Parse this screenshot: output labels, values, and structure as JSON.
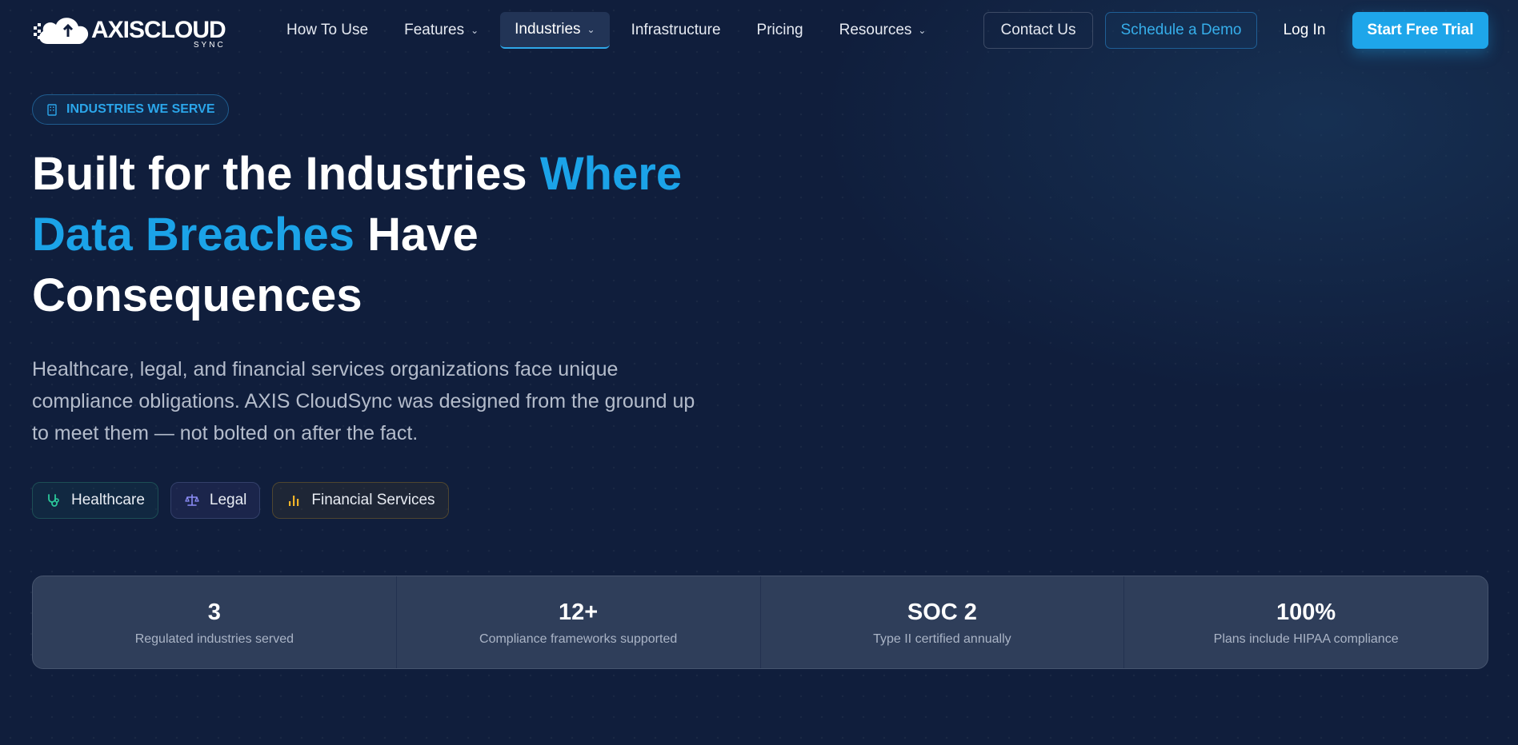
{
  "brand": {
    "name": "AXISCLOUD",
    "sub": "SYNC"
  },
  "nav": {
    "items": [
      {
        "label": "How To Use",
        "dropdown": false
      },
      {
        "label": "Features",
        "dropdown": true
      },
      {
        "label": "Industries",
        "dropdown": true,
        "active": true
      },
      {
        "label": "Infrastructure",
        "dropdown": false
      },
      {
        "label": "Pricing",
        "dropdown": false
      },
      {
        "label": "Resources",
        "dropdown": true
      }
    ],
    "contact": "Contact Us",
    "demo": "Schedule a Demo",
    "login": "Log In",
    "trial": "Start Free Trial"
  },
  "hero": {
    "badge": "INDUSTRIES WE SERVE",
    "headline_1": "Built for the Industries ",
    "headline_accent_1": "Where",
    "headline_accent_2": "Data Breaches",
    "headline_2": " Have",
    "headline_3": "Consequences",
    "subtitle": "Healthcare, legal, and financial services organizations face unique compliance obligations. AXIS CloudSync was designed from the ground up to meet them — not bolted on after the fact.",
    "chips": [
      {
        "label": "Healthcare",
        "icon": "stethoscope-icon",
        "color": "#2bc79a"
      },
      {
        "label": "Legal",
        "icon": "scales-icon",
        "color": "#8b8cf5"
      },
      {
        "label": "Financial Services",
        "icon": "bar-chart-icon",
        "color": "#f0b429"
      }
    ]
  },
  "stats": [
    {
      "value": "3",
      "label": "Regulated industries served"
    },
    {
      "value": "12+",
      "label": "Compliance frameworks supported"
    },
    {
      "value": "SOC 2",
      "label": "Type II certified annually"
    },
    {
      "value": "100%",
      "label": "Plans include HIPAA compliance"
    }
  ],
  "colors": {
    "accent": "#1ea6ea",
    "background": "#101e3c"
  }
}
